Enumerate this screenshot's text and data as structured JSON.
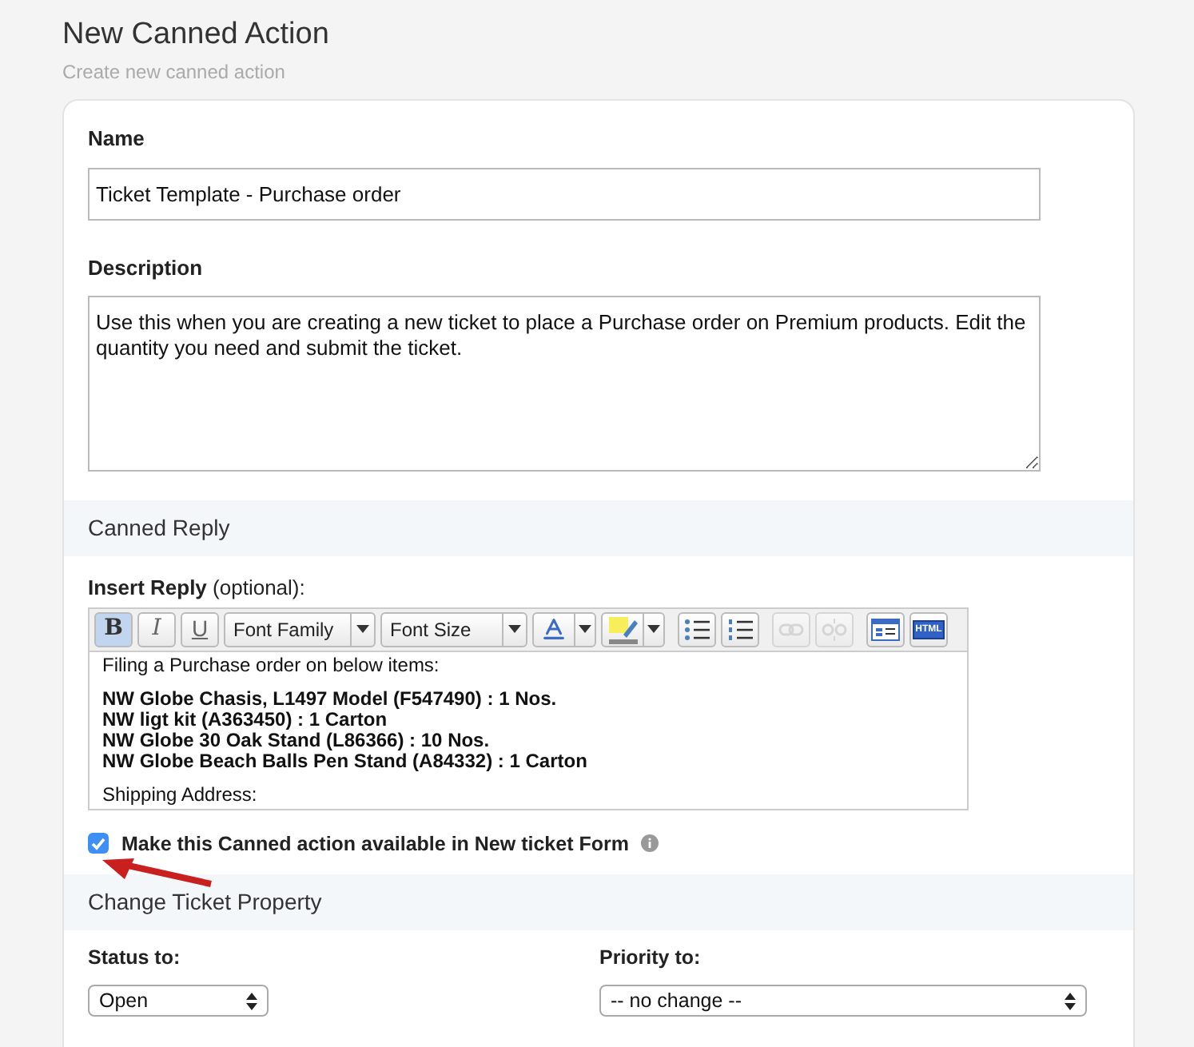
{
  "page": {
    "title": "New Canned Action",
    "subtitle": "Create new canned action"
  },
  "name_field": {
    "label": "Name",
    "value": "Ticket Template - Purchase order"
  },
  "description_field": {
    "label": "Description",
    "value": "Use this when you are creating a new ticket to place a Purchase order on Premium products. Edit the quantity you need and submit the ticket."
  },
  "canned_reply": {
    "heading": "Canned Reply",
    "label": "Insert Reply",
    "label_note": "(optional):",
    "toolbar": [
      {
        "kind": "toggle",
        "label": "B",
        "selected": true
      },
      {
        "kind": "toggle",
        "label": "I",
        "selected": false
      },
      {
        "kind": "toggle",
        "label": "U",
        "selected": false
      },
      {
        "kind": "dropdown",
        "label": "Font Family"
      },
      {
        "kind": "dropdown",
        "label": "Font Size"
      },
      {
        "kind": "color",
        "disabled": false
      },
      {
        "kind": "color",
        "disabled": false
      },
      {
        "kind": "icon",
        "disabled": false
      },
      {
        "kind": "icon",
        "disabled": false
      },
      {
        "kind": "icon",
        "disabled": true
      },
      {
        "kind": "icon",
        "disabled": true
      },
      {
        "kind": "icon",
        "disabled": false
      },
      {
        "kind": "html",
        "label": "HTML",
        "disabled": false
      }
    ],
    "paragraphs": [
      {
        "bold": false,
        "lines": [
          "Filing a Purchase order on below items:"
        ]
      },
      {
        "bold": true,
        "lines": [
          "NW Globe Chasis, L1497 Model (F547490) : 1 Nos.",
          "NW ligt kit (A363450) : 1 Carton",
          "NW Globe 30 Oak Stand (L86366) : 10 Nos.",
          "NW Globe Beach Balls Pen Stand (A84332) : 1 Carton"
        ]
      },
      {
        "bold": false,
        "lines": [
          "Shipping Address:"
        ]
      }
    ],
    "available_checkbox": {
      "label": "Make this Canned action available in New ticket Form",
      "checked": true
    }
  },
  "ticket_property": {
    "heading": "Change Ticket Property",
    "status": {
      "label": "Status to:",
      "value": "Open"
    },
    "priority": {
      "label": "Priority to:",
      "value": "-- no change --"
    }
  }
}
